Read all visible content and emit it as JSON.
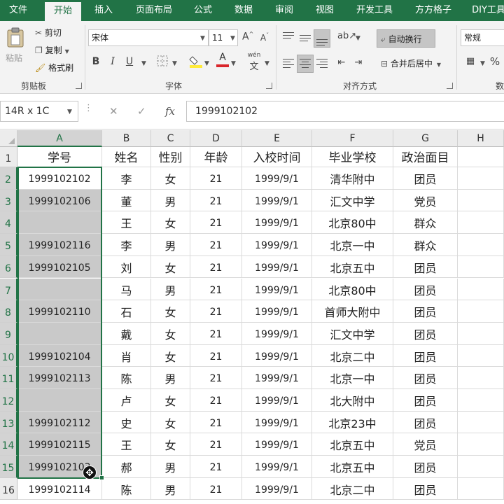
{
  "ribbon_tabs": [
    {
      "label": "文件",
      "active": false
    },
    {
      "label": "开始",
      "active": true
    },
    {
      "label": "插入",
      "active": false
    },
    {
      "label": "页面布局",
      "active": false
    },
    {
      "label": "公式",
      "active": false
    },
    {
      "label": "数据",
      "active": false
    },
    {
      "label": "审阅",
      "active": false
    },
    {
      "label": "视图",
      "active": false
    },
    {
      "label": "开发工具",
      "active": false
    },
    {
      "label": "方方格子",
      "active": false
    },
    {
      "label": "DIY工具",
      "active": false
    }
  ],
  "clipboard": {
    "paste_label": "粘贴",
    "cut_label": "剪切",
    "copy_label": "复制",
    "format_painter_label": "格式刷",
    "group_label": "剪贴板"
  },
  "font": {
    "name": "宋体",
    "size": "11",
    "bold": "B",
    "italic": "I",
    "underline": "U",
    "group_label": "字体",
    "phonetic_label": "wén",
    "font_color": "#d9262b",
    "fill_color": "#ffeb3b"
  },
  "alignment": {
    "wrap_label": "自动换行",
    "merge_label": "合并后居中",
    "group_label": "对齐方式"
  },
  "number": {
    "format": "常规",
    "percent": "%",
    "group_label": "数"
  },
  "name_box": "14R x 1C",
  "fx_label": "fx",
  "formula_value": "1999102102",
  "columns": [
    "A",
    "B",
    "C",
    "D",
    "E",
    "F",
    "G",
    "H"
  ],
  "header_row": [
    "学号",
    "姓名",
    "性别",
    "年龄",
    "入校时间",
    "毕业学校",
    "政治面目"
  ],
  "rows": [
    {
      "num": "1"
    },
    {
      "num": "2",
      "cells": [
        "1999102102",
        "李",
        "女",
        "21",
        "1999/9/1",
        "清华附中",
        "团员"
      ]
    },
    {
      "num": "3",
      "cells": [
        "1999102106",
        "董",
        "男",
        "21",
        "1999/9/1",
        "汇文中学",
        "党员"
      ]
    },
    {
      "num": "4",
      "cells": [
        "",
        "王",
        "女",
        "21",
        "1999/9/1",
        "北京80中",
        "群众"
      ]
    },
    {
      "num": "5",
      "cells": [
        "1999102116",
        "李",
        "男",
        "21",
        "1999/9/1",
        "北京一中",
        "群众"
      ]
    },
    {
      "num": "6",
      "cells": [
        "1999102105",
        "刘",
        "女",
        "21",
        "1999/9/1",
        "北京五中",
        "团员"
      ]
    },
    {
      "num": "7",
      "cells": [
        "",
        "马",
        "男",
        "21",
        "1999/9/1",
        "北京80中",
        "团员"
      ]
    },
    {
      "num": "8",
      "cells": [
        "1999102110",
        "石",
        "女",
        "21",
        "1999/9/1",
        "首师大附中",
        "团员"
      ]
    },
    {
      "num": "9",
      "cells": [
        "",
        "戴",
        "女",
        "21",
        "1999/9/1",
        "汇文中学",
        "团员"
      ]
    },
    {
      "num": "10",
      "cells": [
        "1999102104",
        "肖",
        "女",
        "21",
        "1999/9/1",
        "北京二中",
        "团员"
      ]
    },
    {
      "num": "11",
      "cells": [
        "1999102113",
        "陈",
        "男",
        "21",
        "1999/9/1",
        "北京一中",
        "团员"
      ]
    },
    {
      "num": "12",
      "cells": [
        "",
        "卢",
        "女",
        "21",
        "1999/9/1",
        "北大附中",
        "团员"
      ]
    },
    {
      "num": "13",
      "cells": [
        "1999102112",
        "史",
        "女",
        "21",
        "1999/9/1",
        "北京23中",
        "团员"
      ]
    },
    {
      "num": "14",
      "cells": [
        "1999102115",
        "王",
        "女",
        "21",
        "1999/9/1",
        "北京五中",
        "党员"
      ]
    },
    {
      "num": "15",
      "cells": [
        "1999102103",
        "郝",
        "男",
        "21",
        "1999/9/1",
        "北京五中",
        "团员"
      ]
    },
    {
      "num": "16",
      "cells": [
        "1999102114",
        "陈",
        "男",
        "21",
        "1999/9/1",
        "北京二中",
        "团员"
      ]
    }
  ],
  "colors": {
    "accent": "#217346",
    "selection_fill": "#c9c9c9"
  }
}
